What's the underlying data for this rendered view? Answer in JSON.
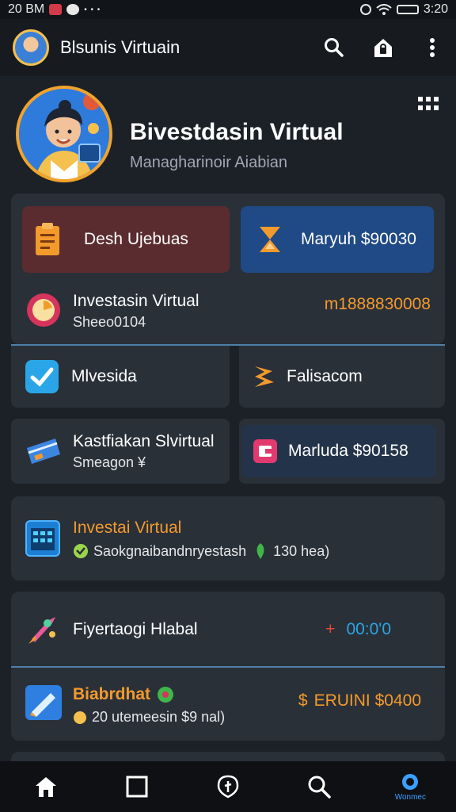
{
  "status_bar": {
    "time": "20 BM",
    "dots": "• • •",
    "clock": "3:20"
  },
  "app_bar": {
    "title": "Blsunis Virtuain"
  },
  "hero": {
    "title": "Bivestdasin Virtual",
    "subtitle": "Managharinoir Aiabian"
  },
  "top_tiles": [
    {
      "label": "Desh Ujebuas",
      "icon": "clipboard-icon"
    },
    {
      "label": "Maryuh $90030",
      "icon": "hourglass-icon"
    }
  ],
  "featured_row": {
    "title": "Investasin Virtual",
    "subtitle": "Sheeo0104",
    "value": "m1888830008"
  },
  "mid_tiles": [
    {
      "label": "Mlvesida",
      "icon": "check-badge-icon"
    },
    {
      "label": "Falisacom",
      "icon": "lightning-icon"
    },
    {
      "title": "Kastfiakan Slvirtual",
      "subtitle": "Smeagon ¥",
      "icon": "card-icon"
    },
    {
      "label": "Marluda $90158",
      "icon": "wallet-icon"
    }
  ],
  "invest_card": {
    "title": "Investai Virtual",
    "subtitle": "Saokgnaibandnryestash",
    "extra": "130 hea)"
  },
  "bottom_card": {
    "row1": {
      "title": "Fiyertaogi Hlabal",
      "sign": "+",
      "value": "00:0'0"
    },
    "row2": {
      "title": "Biabrdhat",
      "subtitle": "20 utemeesin $9 nal)",
      "value": "ERUINI $0400",
      "currency": "$"
    }
  },
  "bottom_nav": {
    "active_label": "Wonmec"
  },
  "colors": {
    "accent_orange": "#f39a2c",
    "accent_blue": "#2aa6e8",
    "tile_red": "#5a2c2f",
    "tile_blue": "#1f4a86"
  }
}
